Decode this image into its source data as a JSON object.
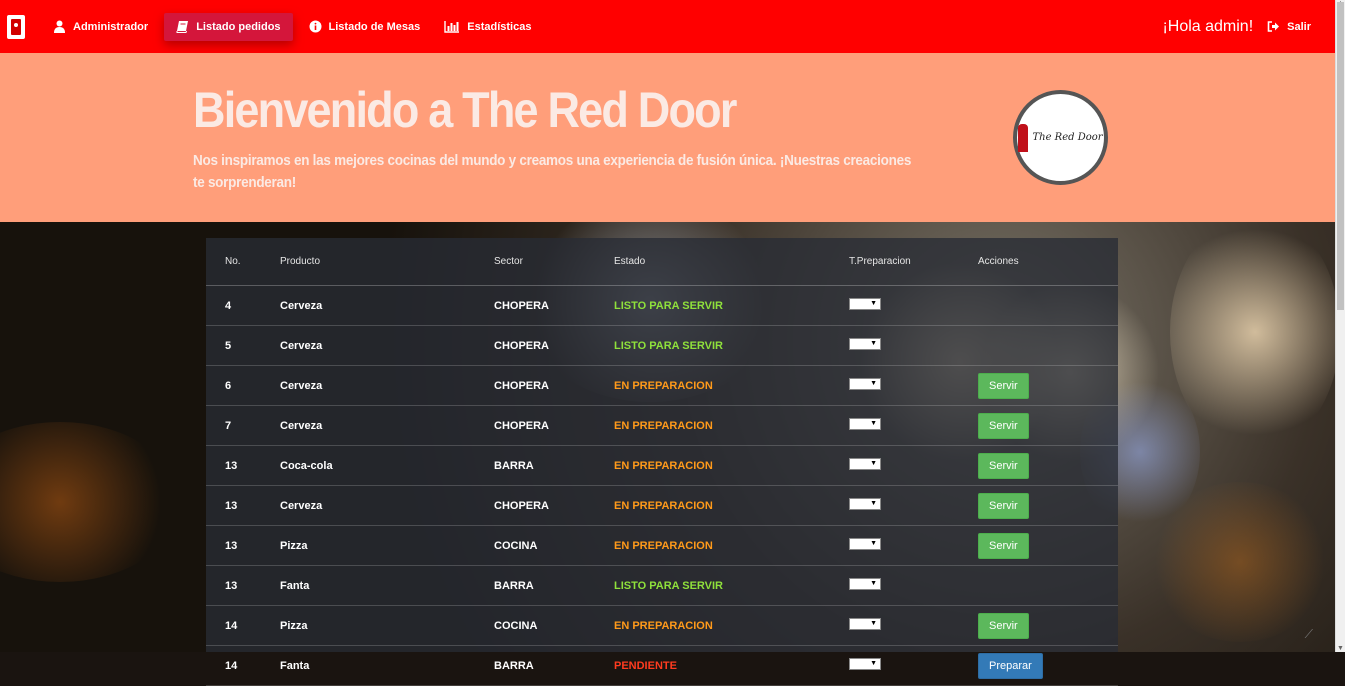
{
  "navbar": {
    "items": [
      {
        "label": "Administrador",
        "icon": "user-icon",
        "active": false
      },
      {
        "label": "Listado pedidos",
        "icon": "book-icon",
        "active": true
      },
      {
        "label": "Listado de Mesas",
        "icon": "info-icon",
        "active": false
      },
      {
        "label": "Estadísticas",
        "icon": "bar-chart-icon",
        "active": false
      }
    ],
    "greeting": "¡Hola admin!",
    "logout_label": "Salir",
    "color": "#ff0000"
  },
  "hero": {
    "title": "Bienvenido a The Red Door",
    "subtitle": "Nos inspiramos en las mejores cocinas del mundo y creamos una experiencia de fusión única. ¡Nuestras creaciones te sorprenderan!",
    "logo_text": "The Red Door",
    "color": "#ff9e7a"
  },
  "table": {
    "headers": [
      "No.",
      "Producto",
      "Sector",
      "Estado",
      "T.Preparacion",
      "Acciones"
    ],
    "rows": [
      {
        "no": "4",
        "producto": "Cerveza",
        "sector": "CHOPERA",
        "estado": "LISTO PARA SERVIR",
        "status": "ready",
        "accion": ""
      },
      {
        "no": "5",
        "producto": "Cerveza",
        "sector": "CHOPERA",
        "estado": "LISTO PARA SERVIR",
        "status": "ready",
        "accion": ""
      },
      {
        "no": "6",
        "producto": "Cerveza",
        "sector": "CHOPERA",
        "estado": "EN PREPARACION",
        "status": "prep",
        "accion": "Servir"
      },
      {
        "no": "7",
        "producto": "Cerveza",
        "sector": "CHOPERA",
        "estado": "EN PREPARACION",
        "status": "prep",
        "accion": "Servir"
      },
      {
        "no": "13",
        "producto": "Coca-cola",
        "sector": "BARRA",
        "estado": "EN PREPARACION",
        "status": "prep",
        "accion": "Servir"
      },
      {
        "no": "13",
        "producto": "Cerveza",
        "sector": "CHOPERA",
        "estado": "EN PREPARACION",
        "status": "prep",
        "accion": "Servir"
      },
      {
        "no": "13",
        "producto": "Pizza",
        "sector": "COCINA",
        "estado": "EN PREPARACION",
        "status": "prep",
        "accion": "Servir"
      },
      {
        "no": "13",
        "producto": "Fanta",
        "sector": "BARRA",
        "estado": "LISTO PARA SERVIR",
        "status": "ready",
        "accion": ""
      },
      {
        "no": "14",
        "producto": "Pizza",
        "sector": "COCINA",
        "estado": "EN PREPARACION",
        "status": "prep",
        "accion": "Servir"
      },
      {
        "no": "14",
        "producto": "Fanta",
        "sector": "BARRA",
        "estado": "PENDIENTE",
        "status": "pend",
        "accion": "Preparar"
      }
    ]
  },
  "status_colors": {
    "ready": "#8fe13b",
    "prep": "#ff9a1a",
    "pend": "#ff3b1f"
  },
  "button_colors": {
    "Servir": "#5cb85c",
    "Preparar": "#337ab7"
  }
}
